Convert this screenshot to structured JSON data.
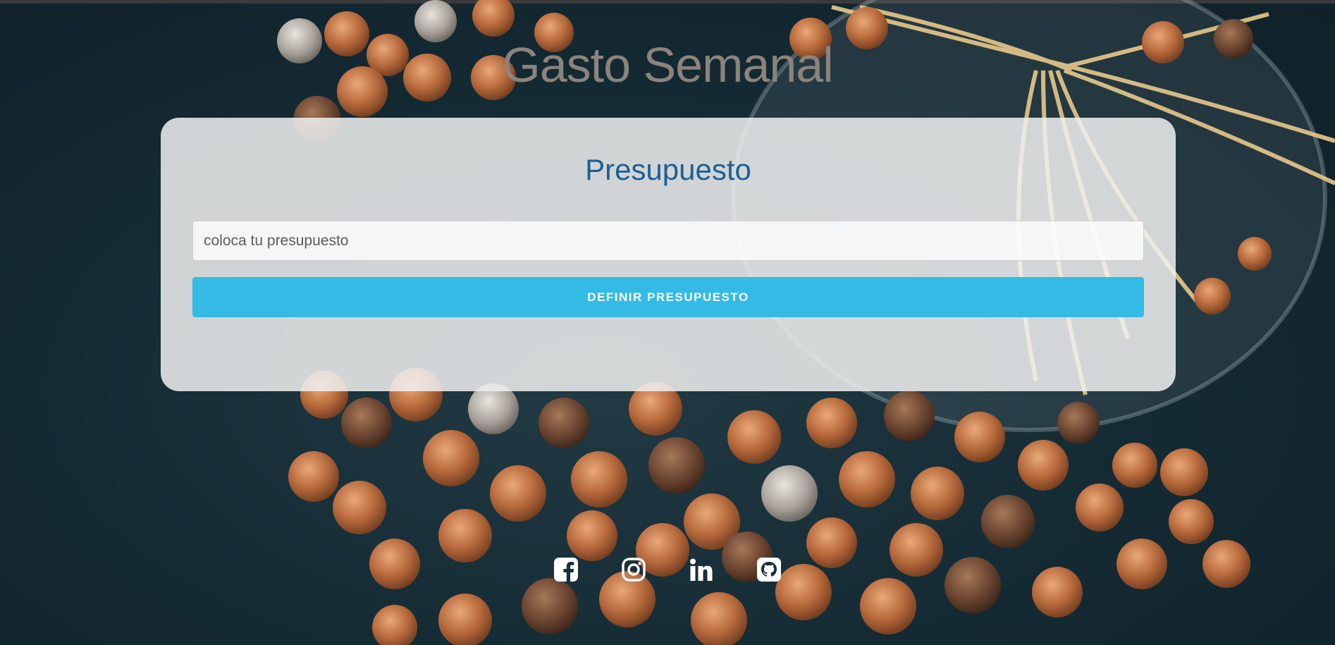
{
  "header": {
    "title": "Gasto Semanal"
  },
  "budget_form": {
    "title": "Presupuesto",
    "input_placeholder": "coloca tu presupuesto",
    "input_value": "",
    "submit_label": "DEFINIR PRESUPUESTO"
  },
  "social_links": [
    {
      "icon": "facebook-icon"
    },
    {
      "icon": "instagram-icon"
    },
    {
      "icon": "linkedin-icon"
    },
    {
      "icon": "github-icon"
    }
  ],
  "colors": {
    "title": "#8c837c",
    "card_title": "#1d5f95",
    "button": "#33bbe6",
    "button_text": "#ffffff",
    "background": "#142a33"
  }
}
